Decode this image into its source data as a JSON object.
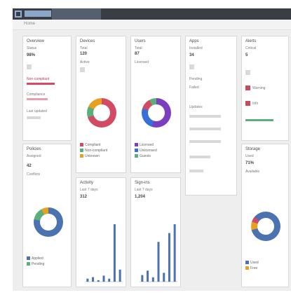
{
  "app": {
    "colors": {
      "accent": "#4a73b0",
      "danger": "#d24a63",
      "success": "#5bb07a",
      "header": "#3a3d44"
    }
  },
  "breadcrumb": "Home",
  "panels": [
    {
      "title": "Overview",
      "lines": [
        "Status",
        "Compliance",
        "Last updated"
      ],
      "value": "98%",
      "link": "Non-compliant"
    },
    {
      "title": "Devices",
      "lines": [
        "Total",
        "Active"
      ],
      "value": "120",
      "legend": [
        "Compliant",
        "Non-compliant",
        "Unknown"
      ]
    },
    {
      "title": "Users",
      "lines": [
        "Total",
        "Licensed"
      ],
      "value": "87",
      "legend": [
        "Licensed",
        "Unlicensed",
        "Guests"
      ]
    },
    {
      "title": "Apps",
      "lines": [
        "Installed",
        "Pending",
        "Failed",
        "Updates"
      ],
      "value": "34"
    },
    {
      "title": "Alerts",
      "lines": [
        "Critical",
        "Warning",
        "Info"
      ],
      "value": "5"
    },
    {
      "title": "Policies",
      "lines": [
        "Assigned",
        "Conflicts"
      ],
      "value": "42",
      "legend": [
        "Applied",
        "Pending"
      ]
    },
    {
      "title": "Activity",
      "lines": [
        "Last 7 days"
      ],
      "value": "312"
    },
    {
      "title": "Sign-ins",
      "lines": [
        "Last 7 days"
      ],
      "value": "1,204"
    },
    {
      "title": "Storage",
      "lines": [
        "Used",
        "Available"
      ],
      "value": "71%",
      "legend": [
        "Used",
        "Free"
      ]
    }
  ],
  "charts": {
    "activity": [
      2,
      3,
      1,
      4,
      2,
      38,
      8
    ],
    "signins": [
      3,
      5,
      2,
      18,
      4,
      22,
      26
    ]
  }
}
